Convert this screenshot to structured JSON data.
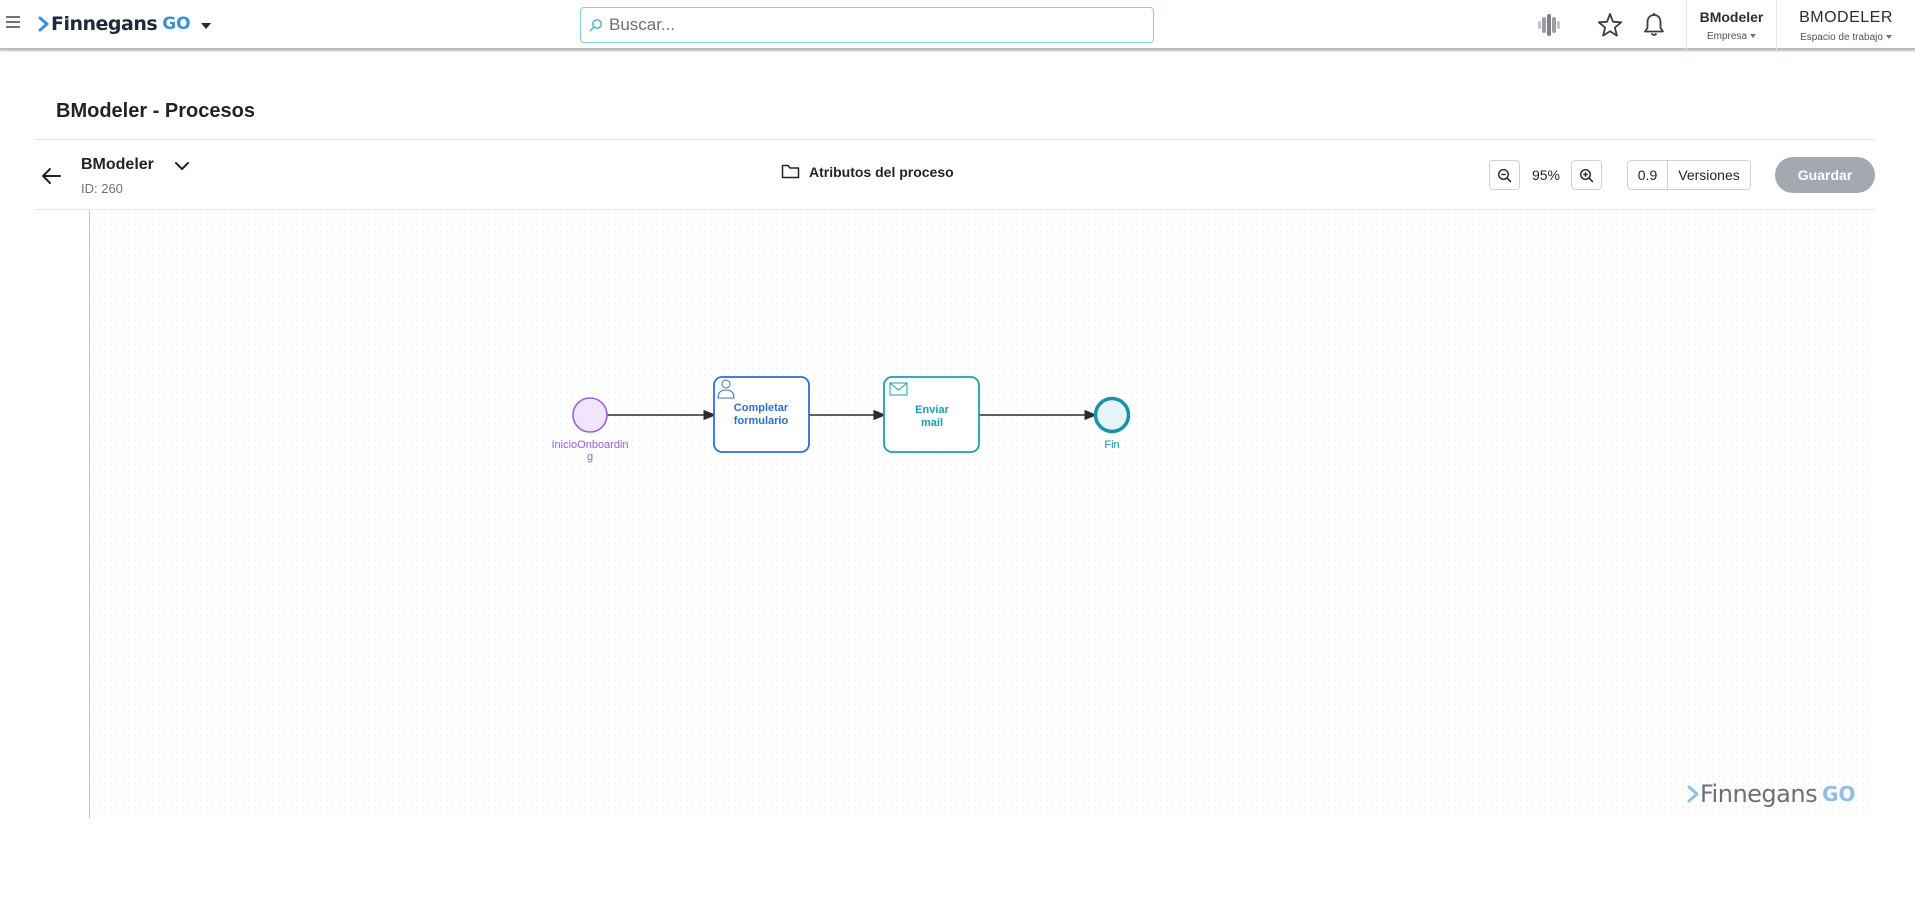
{
  "header": {
    "logo_text": "Finnegans",
    "logo_go": "GO",
    "search_placeholder": "Buscar...",
    "company_name": "BModeler",
    "company_label": "Empresa",
    "workspace_name": "BMODELER",
    "workspace_label": "Espacio de trabajo"
  },
  "page": {
    "title": "BModeler - Procesos"
  },
  "process": {
    "name": "BModeler",
    "id_text": "ID: 260",
    "attributes_label": "Atributos del proceso",
    "zoom": "95%",
    "version": "0.9",
    "versions_label": "Versiones",
    "save_label": "Guardar"
  },
  "diagram": {
    "start_event_label_1": "InicioOnboardin",
    "start_event_label_2": "g",
    "task1_line1": "Completar",
    "task1_line2": "formulario",
    "task2_line1": "Enviar",
    "task2_line2": "mail",
    "end_event_label": "Fin",
    "colors": {
      "start": "#9b5de5",
      "start_fill": "#efe6fb",
      "user_task": "#2d6fd8",
      "send_task": "#1a9fae",
      "end": "#1793a8",
      "end_fill": "#e6f5f7"
    }
  },
  "watermark": {
    "text": "Finnegans",
    "go": "GO"
  },
  "icons": [
    "hamburger-icon",
    "logo-chevron-icon",
    "search-icon",
    "ai-icon",
    "star-icon",
    "bell-icon",
    "back-arrow-icon",
    "chevron-down-icon",
    "folder-icon",
    "zoom-out-icon",
    "zoom-in-icon",
    "user-task-icon",
    "envelope-icon"
  ]
}
